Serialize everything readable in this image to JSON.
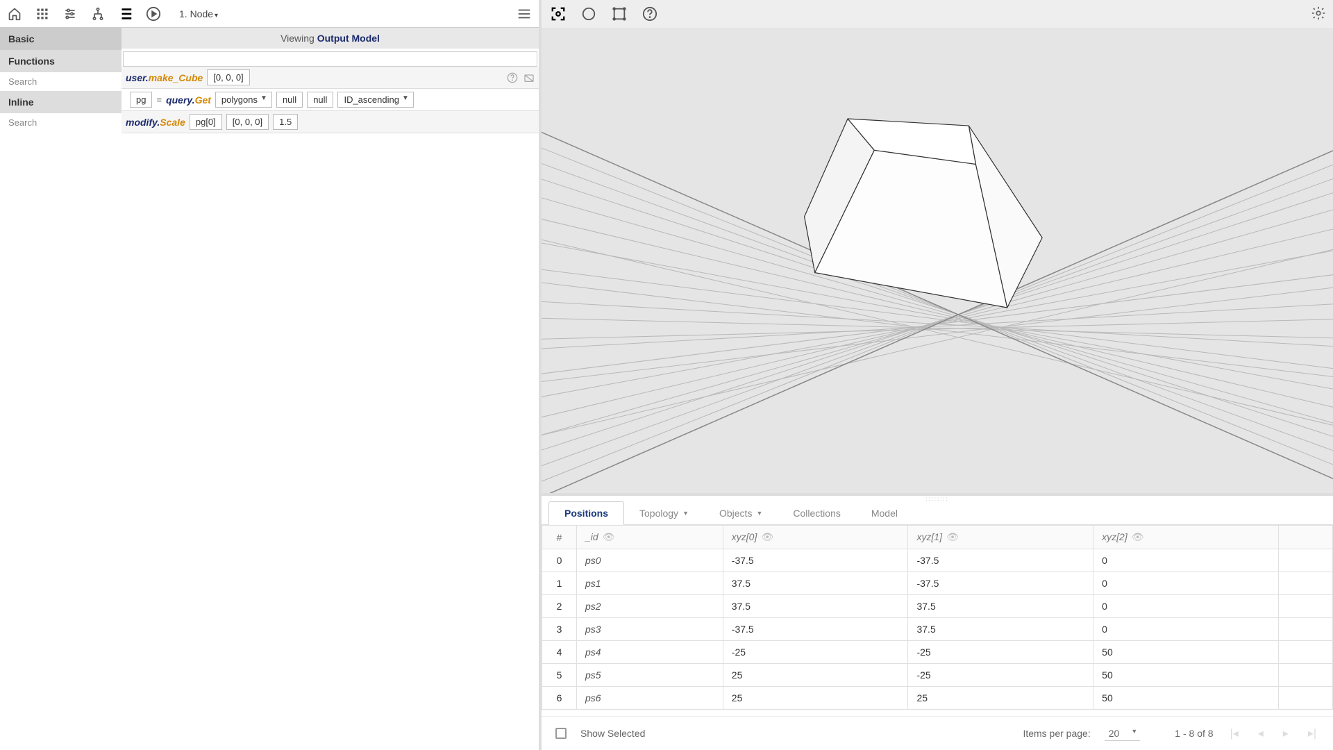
{
  "toolbar": {
    "node_label": "1. Node"
  },
  "sidebar": {
    "basic": "Basic",
    "functions": "Functions",
    "inline": "Inline",
    "search": "Search"
  },
  "viewing": {
    "prefix": "Viewing ",
    "target": "Output Model"
  },
  "code": {
    "line1": {
      "ns": "user.",
      "fn": "make_Cube",
      "p1": "[0, 0, 0]"
    },
    "line2": {
      "var": "pg",
      "eq": "=",
      "ns": "query.",
      "fn": "Get",
      "p1": "polygons",
      "p2": "null",
      "p3": "null",
      "p4": "ID_ascending"
    },
    "line3": {
      "ns": "modify.",
      "fn": "Scale",
      "p1": "pg[0]",
      "p2": "[0, 0, 0]",
      "p3": "1.5"
    }
  },
  "floats": {
    "pg": "pg"
  },
  "tabs": {
    "positions": "Positions",
    "topology": "Topology",
    "objects": "Objects",
    "collections": "Collections",
    "model": "Model"
  },
  "table": {
    "headers": {
      "num": "#",
      "id": "_id",
      "c0": "xyz[0]",
      "c1": "xyz[1]",
      "c2": "xyz[2]"
    },
    "rows": [
      {
        "n": "0",
        "id": "ps0",
        "c0": "-37.5",
        "c1": "-37.5",
        "c2": "0"
      },
      {
        "n": "1",
        "id": "ps1",
        "c0": "37.5",
        "c1": "-37.5",
        "c2": "0"
      },
      {
        "n": "2",
        "id": "ps2",
        "c0": "37.5",
        "c1": "37.5",
        "c2": "0"
      },
      {
        "n": "3",
        "id": "ps3",
        "c0": "-37.5",
        "c1": "37.5",
        "c2": "0"
      },
      {
        "n": "4",
        "id": "ps4",
        "c0": "-25",
        "c1": "-25",
        "c2": "50"
      },
      {
        "n": "5",
        "id": "ps5",
        "c0": "25",
        "c1": "-25",
        "c2": "50"
      },
      {
        "n": "6",
        "id": "ps6",
        "c0": "25",
        "c1": "25",
        "c2": "50"
      }
    ]
  },
  "paginator": {
    "show_selected": "Show Selected",
    "items_label": "Items per page:",
    "items_value": "20",
    "range": "1 - 8 of 8"
  }
}
